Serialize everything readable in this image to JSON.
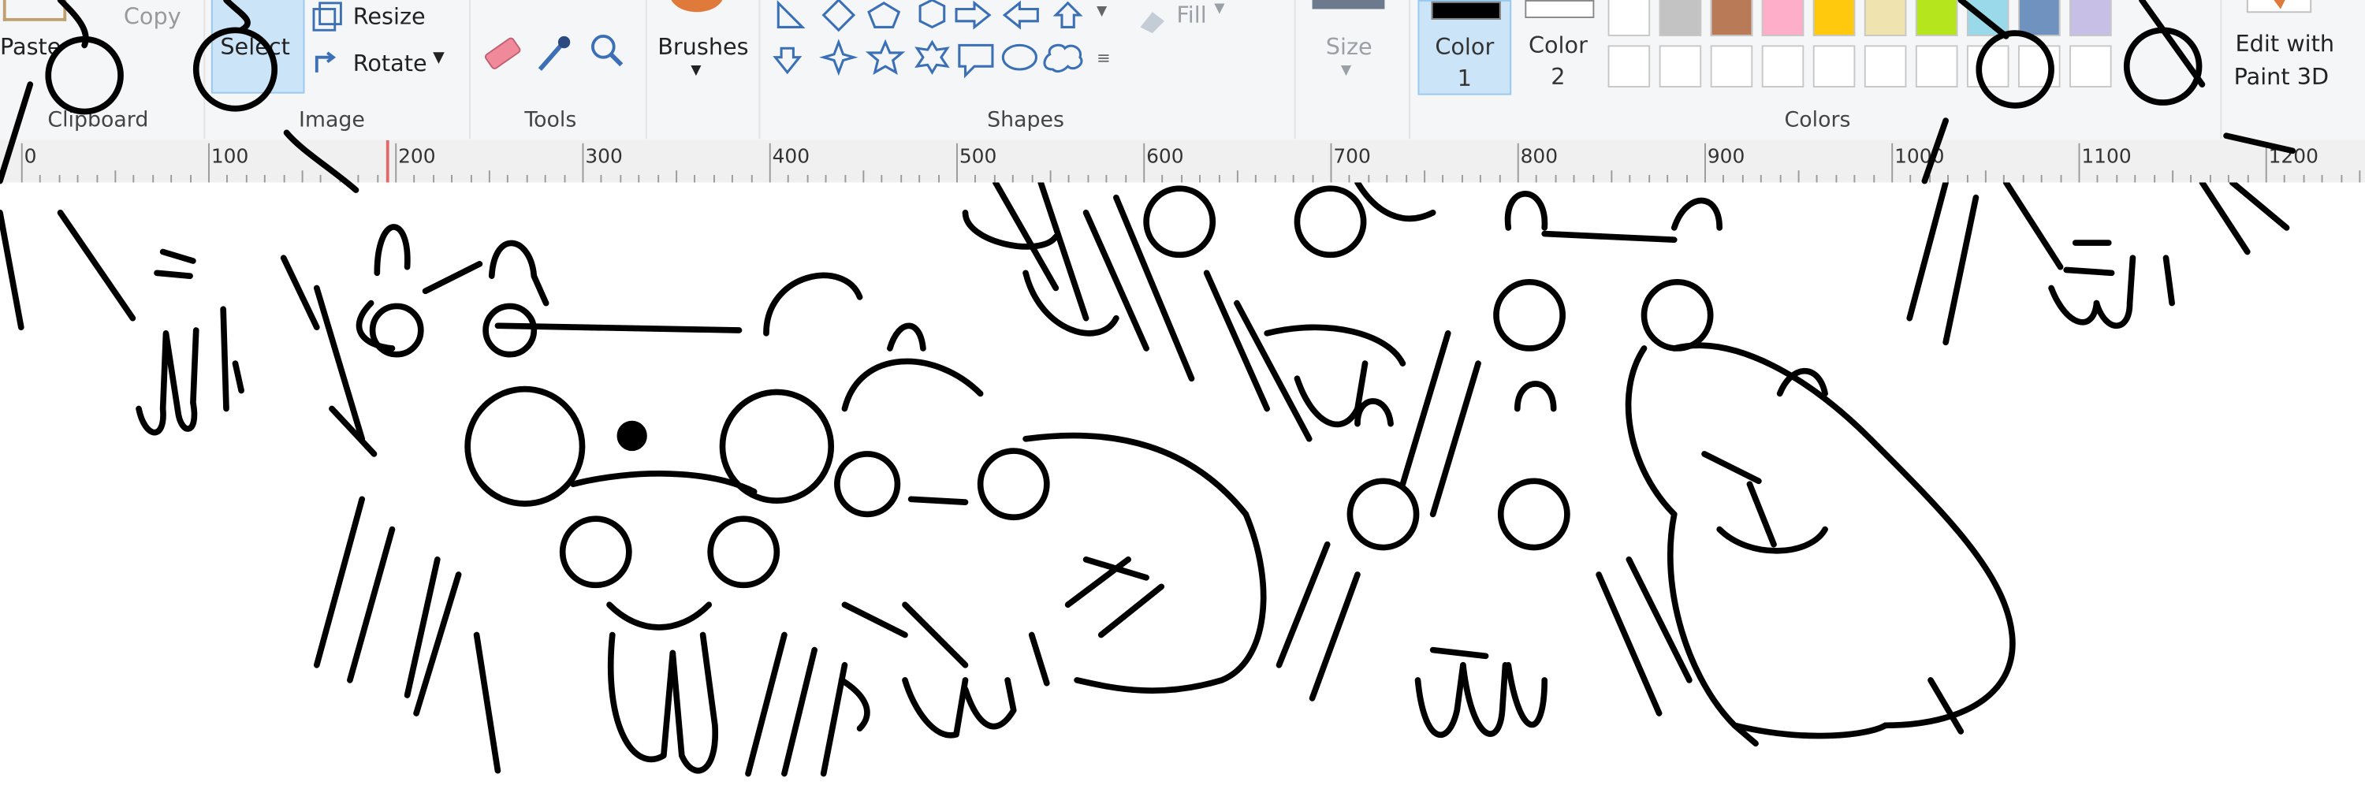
{
  "app": {
    "name": "Paint",
    "canvas_content": "hand-drawn hamster doodles"
  },
  "ribbon": {
    "clipboard": {
      "paste_label": "Paste",
      "copy_label": "Copy",
      "group_label": "Clipboard"
    },
    "image": {
      "select_label": "Select",
      "resize_label": "Resize",
      "rotate_label": "Rotate",
      "group_label": "Image"
    },
    "tools": {
      "group_label": "Tools",
      "icons": [
        "eraser-icon",
        "color-picker-icon",
        "magnifier-icon"
      ]
    },
    "brushes": {
      "label": "Brushes"
    },
    "shapes": {
      "fill_label": "Fill",
      "group_label": "Shapes"
    },
    "size": {
      "label": "Size"
    },
    "colors": {
      "color1_label": "Color",
      "color1_num": "1",
      "color2_label": "Color",
      "color2_num": "2",
      "group_label": "Colors",
      "color1_value": "#000000",
      "color2_value": "#ffffff",
      "palette_row1": [
        "#ffffff",
        "#c3c3c3",
        "#b97a57",
        "#ffaec9",
        "#ffc90e",
        "#efe4b0",
        "#b5e61d",
        "#99d9ea",
        "#7092be",
        "#c8bfe7"
      ],
      "palette_row2": [
        "#ffffff",
        "#ffffff",
        "#ffffff",
        "#ffffff",
        "#ffffff",
        "#ffffff",
        "#ffffff",
        "#ffffff",
        "#ffffff",
        "#ffffff"
      ]
    },
    "paint3d": {
      "line1": "Edit with",
      "line2": "Paint 3D"
    }
  },
  "ruler": {
    "labels": [
      "0",
      "100",
      "200",
      "300",
      "400",
      "500",
      "600",
      "700",
      "800",
      "900",
      "1000",
      "1100",
      "1200"
    ]
  }
}
